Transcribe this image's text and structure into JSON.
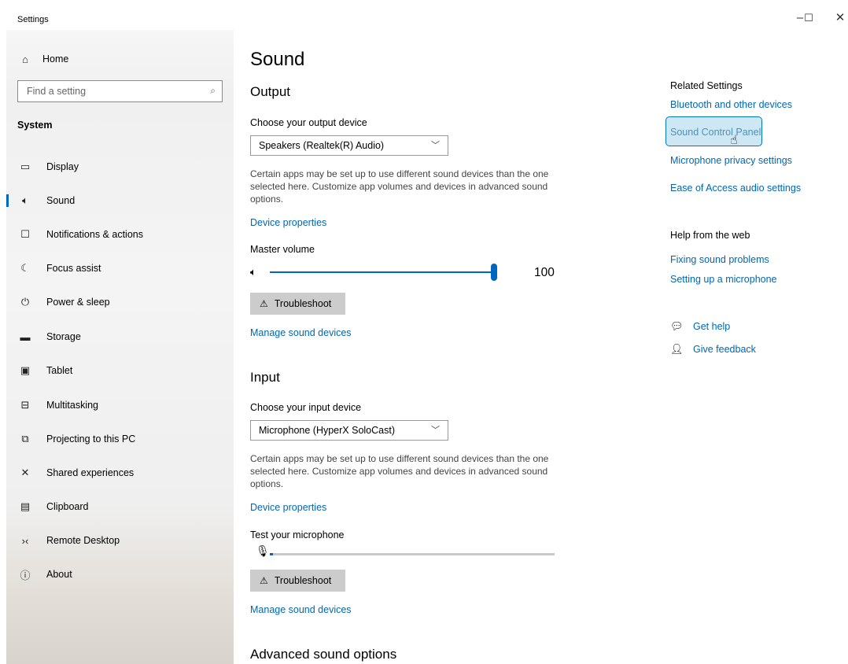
{
  "window": {
    "title": "Settings",
    "minimize": "–",
    "maximize": "☐",
    "close": "✕"
  },
  "sidebar": {
    "home": "Home",
    "search_placeholder": "Find a setting",
    "section": "System",
    "items": [
      {
        "label": "Display"
      },
      {
        "label": "Sound"
      },
      {
        "label": "Notifications & actions"
      },
      {
        "label": "Focus assist"
      },
      {
        "label": "Power & sleep"
      },
      {
        "label": "Storage"
      },
      {
        "label": "Tablet"
      },
      {
        "label": "Multitasking"
      },
      {
        "label": "Projecting to this PC"
      },
      {
        "label": "Shared experiences"
      },
      {
        "label": "Clipboard"
      },
      {
        "label": "Remote Desktop"
      },
      {
        "label": "About"
      }
    ],
    "active_item": "Sound"
  },
  "main": {
    "title": "Sound",
    "output": {
      "heading": "Output",
      "choose_label": "Choose your output device",
      "device": "Speakers (Realtek(R) Audio)",
      "description": "Certain apps may be set up to use different sound devices than the one selected here. Customize app volumes and devices in advanced sound options.",
      "device_properties": "Device properties",
      "master_volume_label": "Master volume",
      "volume": "100",
      "troubleshoot": "Troubleshoot",
      "manage": "Manage sound devices"
    },
    "input": {
      "heading": "Input",
      "choose_label": "Choose your input device",
      "device": "Microphone (HyperX SoloCast)",
      "description": "Certain apps may be set up to use different sound devices than the one selected here. Customize app volumes and devices in advanced sound options.",
      "device_properties": "Device properties",
      "test_label": "Test your microphone",
      "mic_level": 0.01,
      "troubleshoot": "Troubleshoot",
      "manage": "Manage sound devices"
    },
    "advanced_heading": "Advanced sound options"
  },
  "related": {
    "title": "Related Settings",
    "links": [
      "Bluetooth and other devices",
      "Sound Control Panel",
      "Microphone privacy settings",
      "Ease of Access audio settings"
    ],
    "hovered": "Sound Control Panel"
  },
  "help": {
    "title": "Help from the web",
    "links": [
      "Fixing sound problems",
      "Setting up a microphone"
    ],
    "get_help": "Get help",
    "give_feedback": "Give feedback"
  },
  "colors": {
    "accent": "#0067c0",
    "link": "#0066b4",
    "hover_bg": "#cde7f4"
  }
}
